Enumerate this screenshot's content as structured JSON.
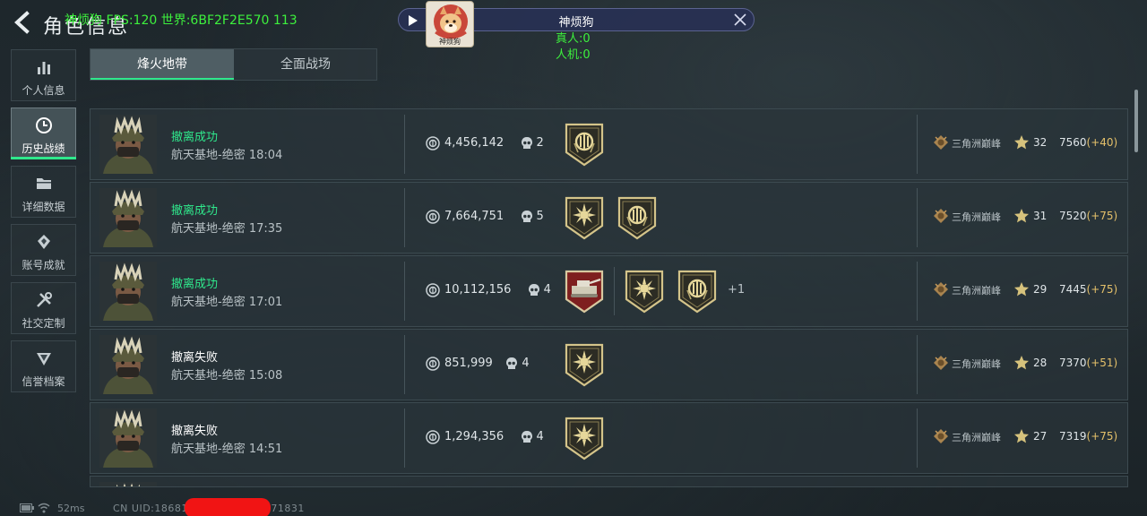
{
  "header": {
    "title": "角色信息",
    "debug_overlay": "神烦狗 FPS:120 世界:6BF2F2E570 113"
  },
  "streamer": {
    "name": "神烦狗",
    "avatar_caption": "神烦狗",
    "real_players": "真人:0",
    "bots": "人机:0"
  },
  "sidebar": {
    "items": [
      {
        "label": "个人信息",
        "icon": "bar-chart-icon"
      },
      {
        "label": "历史战绩",
        "icon": "clock-icon",
        "active": true
      },
      {
        "label": "详细数据",
        "icon": "folder-icon"
      },
      {
        "label": "账号成就",
        "icon": "achievement-icon"
      },
      {
        "label": "社交定制",
        "icon": "tools-icon"
      },
      {
        "label": "信誉档案",
        "icon": "credit-icon"
      }
    ]
  },
  "tabs": [
    {
      "label": "烽火地带",
      "active": true
    },
    {
      "label": "全面战场",
      "active": false
    }
  ],
  "records": [
    {
      "status": "撤离成功",
      "success": true,
      "map_time": "航天基地-绝密 18:04",
      "value": "4,456,142",
      "kills": "2",
      "badges": [
        "emblem"
      ],
      "more": "",
      "rank": "三角洲巅峰",
      "level": "32",
      "score": "7560",
      "delta": "(+40)"
    },
    {
      "status": "撤离成功",
      "success": true,
      "map_time": "航天基地-绝密 17:35",
      "value": "7,664,751",
      "kills": "5",
      "badges": [
        "sun",
        "emblem"
      ],
      "more": "",
      "rank": "三角洲巅峰",
      "level": "31",
      "score": "7520",
      "delta": "(+75)"
    },
    {
      "status": "撤离成功",
      "success": true,
      "map_time": "航天基地-绝密 17:01",
      "value": "10,112,156",
      "kills": "4",
      "badges": [
        "tank",
        "sun",
        "emblem"
      ],
      "more": "+1",
      "rank": "三角洲巅峰",
      "level": "29",
      "score": "7445",
      "delta": "(+75)"
    },
    {
      "status": "撤离失败",
      "success": false,
      "map_time": "航天基地-绝密 15:08",
      "value": "851,999",
      "kills": "4",
      "badges": [
        "sun"
      ],
      "more": "",
      "rank": "三角洲巅峰",
      "level": "28",
      "score": "7370",
      "delta": "(+51)"
    },
    {
      "status": "撤离失败",
      "success": false,
      "map_time": "航天基地-绝密 14:51",
      "value": "1,294,356",
      "kills": "4",
      "badges": [
        "sun"
      ],
      "more": "",
      "rank": "三角洲巅峰",
      "level": "27",
      "score": "7319",
      "delta": "(+75)"
    }
  ],
  "footer": {
    "ping": "52ms",
    "uid": "CN UID:18681          1936_202605271831"
  },
  "colors": {
    "success": "#2fe88c",
    "fail": "#ffffff",
    "delta": "#e4c06a",
    "debug": "#3df03d",
    "redaction": "#f11414"
  }
}
